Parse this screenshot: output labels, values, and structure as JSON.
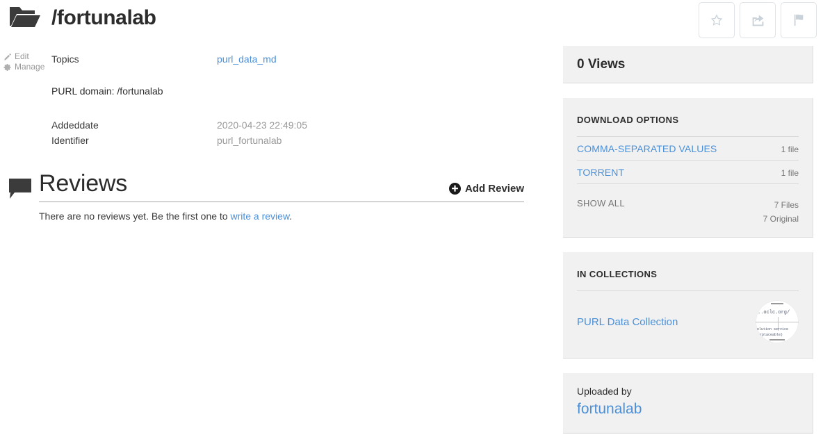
{
  "header": {
    "title": "/fortunalab",
    "folder_icon": "open-folder-icon"
  },
  "actions": [
    {
      "name": "favorite",
      "label": "Favorite",
      "icon": "star-icon"
    },
    {
      "name": "share",
      "label": "Share",
      "icon": "share-icon"
    },
    {
      "name": "flag",
      "label": "Flag",
      "icon": "flag-icon"
    }
  ],
  "left_rail": {
    "edit_label": "Edit",
    "manage_label": "Manage"
  },
  "metadata": {
    "topics_key": "Topics",
    "topics_value": "purl_data_md",
    "purl_domain_note": "PURL domain: /fortunalab",
    "rows": [
      {
        "key": "Addeddate",
        "value": "2020-04-23 22:49:05"
      },
      {
        "key": "Identifier",
        "value": "purl_fortunalab"
      }
    ]
  },
  "reviews": {
    "title": "Reviews",
    "add_review_label": "Add Review",
    "empty_prefix": "There are no reviews yet. Be the first one to ",
    "empty_link": "write a review",
    "empty_suffix": "."
  },
  "sidebar": {
    "views": "0 Views",
    "download": {
      "heading": "DOWNLOAD OPTIONS",
      "rows": [
        {
          "name": "COMMA-SEPARATED VALUES",
          "count": "1 file"
        },
        {
          "name": "TORRENT",
          "count": "1 file"
        }
      ],
      "show_all_label": "SHOW ALL",
      "total_files": "7 Files",
      "total_original": "7 Original"
    },
    "collections": {
      "heading": "IN COLLECTIONS",
      "items": [
        {
          "label": "PURL Data Collection",
          "thumb_text_1": "..oclc.org/",
          "thumb_text_2": "olution service",
          "thumb_text_3": "rplaceable)"
        }
      ]
    },
    "uploader": {
      "label": "Uploaded by",
      "name": "fortunalab"
    }
  },
  "colors": {
    "link": "#4a90d9",
    "panel_bg": "#f1f1f1",
    "text": "#2c2c2c",
    "muted": "#999999",
    "icon_light": "#c9d2d9"
  }
}
